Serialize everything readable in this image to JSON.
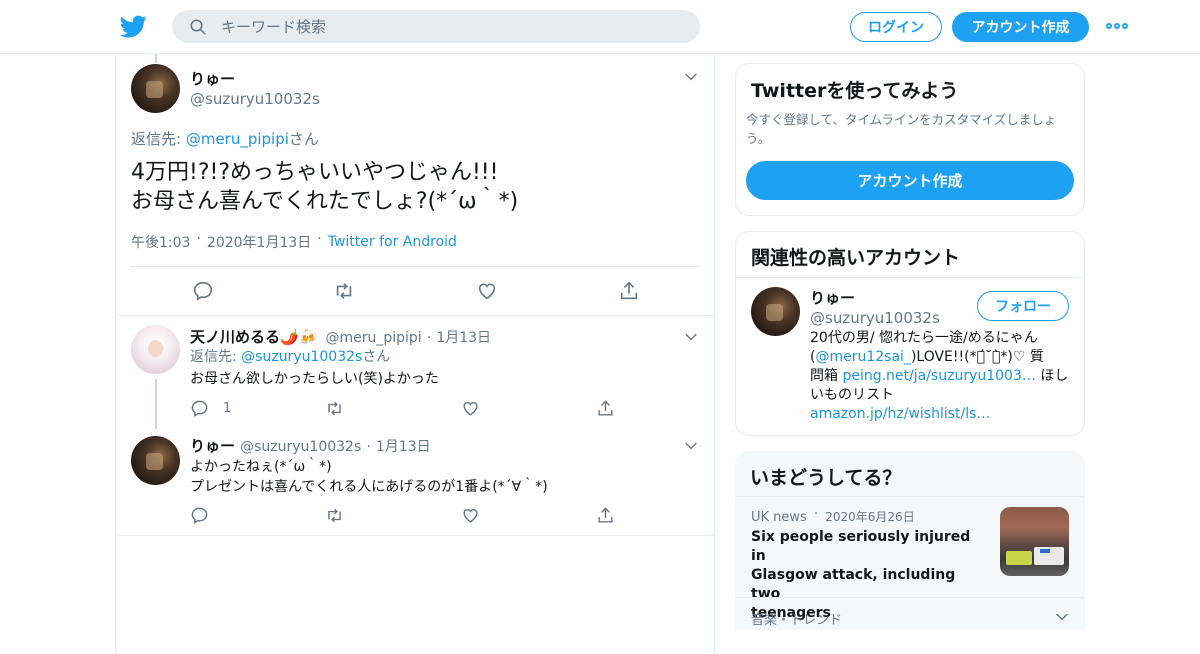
{
  "header": {
    "search_placeholder": "キーワード検索",
    "login_label": "ログイン",
    "signup_label": "アカウント作成"
  },
  "tweet": {
    "name": "りゅー",
    "handle": "@suzuryu10032s",
    "replying_prefix": "返信先: ",
    "replying_to": "@meru_pipipi",
    "replying_suffix": "さん",
    "text_line1": "4万円!?!?めっちゃいいやつじゃん!!!",
    "text_line2": "お母さん喜んでくれたでしょ?(*´ω｀*)",
    "time": "午後1:03",
    "date": "2020年1月13日",
    "source": "Twitter for Android"
  },
  "replies": [
    {
      "name": "天ノ川めるる🌶️🍻",
      "handle": "@meru_pipipi",
      "date": "1月13日",
      "replying_prefix": "返信先: ",
      "replying_to": "@suzuryu10032s",
      "replying_suffix": "さん",
      "text": "お母さん欲しかったらしい(笑)よかった",
      "reply_count": "1"
    },
    {
      "name": "りゅー",
      "handle": "@suzuryu10032s",
      "date": "1月13日",
      "text_line1": "よかったねぇ(*´ω｀*)",
      "text_line2": "プレゼントは喜んでくれる人にあげるのが1番よ(*´∀｀*)"
    }
  ],
  "sidebar": {
    "join": {
      "title": "Twitterを使ってみよう",
      "desc_line1": "今すぐ登録して、タイムラインをカスタマイズしましょ",
      "desc_line2": "う。",
      "button": "アカウント作成"
    },
    "related": {
      "title": "関連性の高いアカウント",
      "name": "りゅー",
      "handle": "@suzuryu10032s",
      "follow": "フォロー",
      "bio_1": "20代の男/ 惚れたら一途/めるにゃん",
      "bio_2a": "(",
      "bio_2link": "@meru12sai_",
      "bio_2b": ")LOVE!!(*ฅ́˘ฅ̀*)♡ 質",
      "bio_3a": "問箱 ",
      "bio_3link": "peing.net/ja/suzuryu1003…",
      "bio_3b": " ほし",
      "bio_4": "いものリスト",
      "bio_5link": "amazon.jp/hz/wishlist/ls…"
    },
    "trends": {
      "title": "いまどうしてる？",
      "news_source": "UK news",
      "news_date": "2020年6月26日",
      "news_1": "Six people seriously injured in",
      "news_2": "Glasgow attack, including two",
      "news_3": "teenagers",
      "trend_label": "音楽・トレンド"
    }
  },
  "colors": {
    "brand": "#1da1f2",
    "link": "#1b95e0",
    "muted": "#657786"
  }
}
